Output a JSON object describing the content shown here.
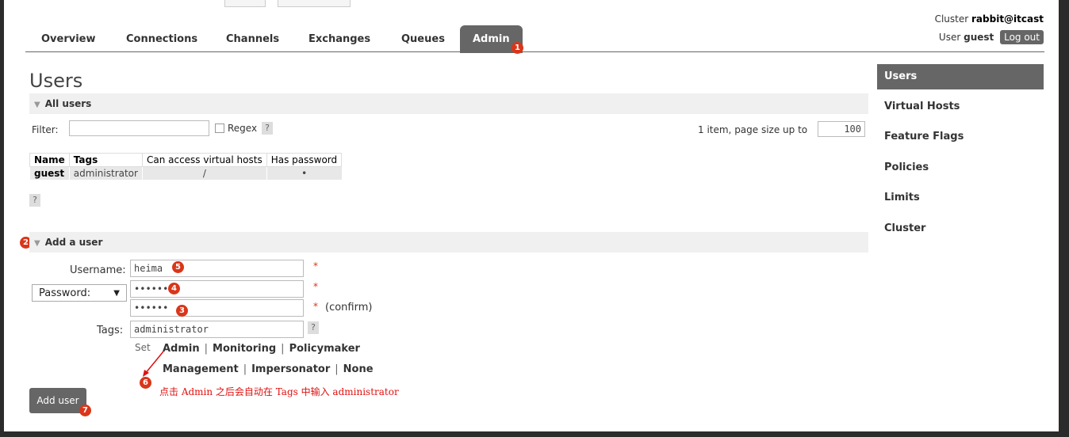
{
  "header": {
    "cluster_label": "Cluster",
    "cluster_name": "rabbit@itcast",
    "user_label": "User",
    "user_name": "guest",
    "logout_label": "Log out"
  },
  "nav": {
    "tabs": [
      "Overview",
      "Connections",
      "Channels",
      "Exchanges",
      "Queues",
      "Admin"
    ],
    "active": "Admin"
  },
  "page_title": "Users",
  "all_users": {
    "title": "All users",
    "filter_label": "Filter:",
    "regex_label": "Regex",
    "help": "?",
    "paging_text": "1 item, page size up to",
    "page_size": "100",
    "columns": [
      "Name",
      "Tags",
      "Can access virtual hosts",
      "Has password"
    ],
    "rows": [
      {
        "name": "guest",
        "tags": "administrator",
        "vhosts": "/",
        "has_password": "•"
      }
    ]
  },
  "add_user": {
    "title": "Add a user",
    "username_label": "Username:",
    "username_value": "heima",
    "password_select": "Password:",
    "password_value": "••••••",
    "password_confirm_value": "••••••",
    "confirm_label": "(confirm)",
    "required_mark": "*",
    "tags_label": "Tags:",
    "tags_value": "administrator",
    "set_label": "Set",
    "tag_links_row1": [
      "Admin",
      "Monitoring",
      "Policymaker"
    ],
    "tag_links_row2": [
      "Management",
      "Impersonator",
      "None"
    ],
    "separator": "|",
    "submit_label": "Add user"
  },
  "annotation_note": "点击 Admin 之后会自动在 Tags 中输入 administrator",
  "badges": [
    "1",
    "2",
    "3",
    "4",
    "5",
    "6",
    "7"
  ],
  "sidebar": {
    "items": [
      "Users",
      "Virtual Hosts",
      "Feature Flags",
      "Policies",
      "Limits",
      "Cluster"
    ],
    "active": "Users"
  },
  "colors": {
    "accent": "#666666",
    "badge": "#d9361a",
    "annotation": "#e01010"
  }
}
